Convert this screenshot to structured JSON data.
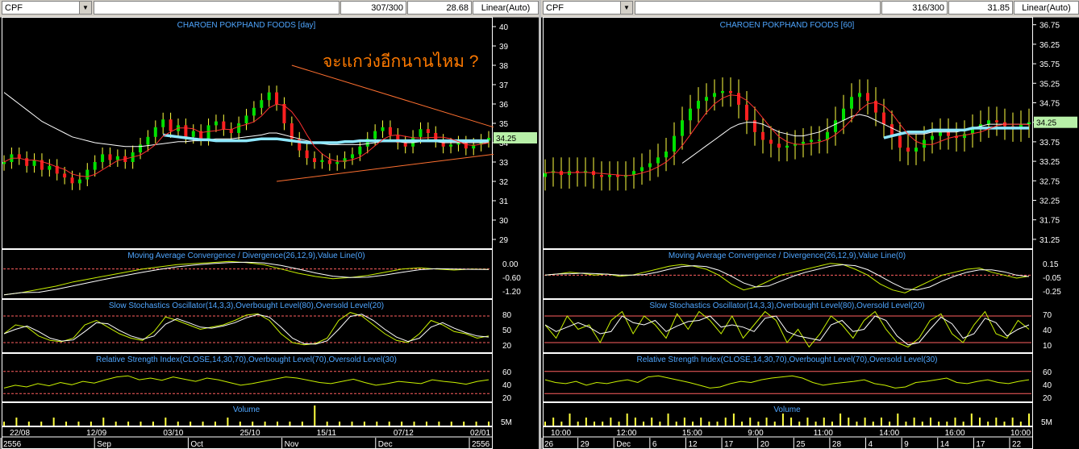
{
  "colors": {
    "bg": "#000000",
    "grid": "#ffffff",
    "title": "#4fa6ff",
    "axis_text": "#ffffff",
    "price_tag_bg": "#b8f0a8",
    "ob_line": "#ff6060",
    "osc_line": "#c8f000",
    "osc_signal": "#ffffff",
    "macd_line": "#c8f000",
    "trend_line": "#ff7030",
    "cyan_ma": "#8ee8ff",
    "annot": "#ff7a00"
  },
  "left": {
    "symbol": "CPF",
    "counter": "307/300",
    "price_readout": "28.68",
    "scale": "Linear(Auto)",
    "title": "CHAROEN POKPHAND FOODS [day]",
    "annotation": "จะแกว่งอีกนานไหม ?",
    "last_price": "34.25",
    "macd_title": "Moving Average Convergence / Divergence(26,12,9),Value Line(0)",
    "stoch_title": "Slow Stochastics Oscillator(14,3,3),Overbought Level(80),Oversold Level(20)",
    "rsi_title": "Relative Strength Index(CLOSE,14,30,70),Overbought Level(70),Oversold Level(30)",
    "vol_title": "Volume",
    "price_ticks": [
      "40",
      "39",
      "38",
      "37",
      "36",
      "35",
      "34",
      "33",
      "32",
      "31",
      "30",
      "29"
    ],
    "macd_ticks": [
      "0.00",
      "-0.60",
      "-1.20"
    ],
    "stoch_ticks": [
      "80",
      "50",
      "20"
    ],
    "rsi_ticks": [
      "60",
      "40",
      "20"
    ],
    "vol_ticks": [
      "5M"
    ],
    "date_labels_top": [
      "22/08",
      "12/09",
      "03/10",
      "25/10",
      "15/11",
      "07/12",
      "02/01"
    ],
    "date_labels_bottom": [
      "2556",
      "Sep",
      "Oct",
      "Nov",
      "Dec",
      "2556"
    ]
  },
  "right": {
    "symbol": "CPF",
    "counter": "316/300",
    "price_readout": "31.85",
    "scale": "Linear(Auto)",
    "title": "CHAROEN POKPHAND FOODS [60]",
    "last_price": "34.25",
    "macd_title": "Moving Average Convergence / Divergence(26,12,9),Value Line(0)",
    "stoch_title": "Slow Stochastics Oscillator(14,3,3),Overbought Level(80),Oversold Level(20)",
    "rsi_title": "Relative Strength Index(CLOSE,14,30,70),Overbought Level(70),Oversold Level(30)",
    "vol_title": "Volume",
    "price_ticks": [
      "36.75",
      "36.25",
      "35.75",
      "35.25",
      "34.75",
      "34.25",
      "33.75",
      "33.25",
      "32.75",
      "32.25",
      "31.75",
      "31.25"
    ],
    "macd_ticks": [
      "0.15",
      "-0.05",
      "-0.25"
    ],
    "stoch_ticks": [
      "70",
      "40",
      "10"
    ],
    "rsi_ticks": [
      "60",
      "40",
      "20"
    ],
    "vol_ticks": [
      "5M"
    ],
    "date_labels_top": [
      "10:00",
      "12:00",
      "15:00",
      "9:00",
      "11:00",
      "14:00",
      "16:00",
      "10:00"
    ],
    "date_labels_bottom": [
      "26",
      "29",
      "Dec",
      "6",
      "12",
      "17",
      "20",
      "25",
      "28",
      "4",
      "9",
      "14",
      "17",
      "22"
    ]
  },
  "chart_data": [
    {
      "type": "candlestick",
      "panel": "left",
      "title": "CHAROEN POKPHAND FOODS [day]",
      "ylim": [
        28.5,
        40.5
      ],
      "close": [
        33.0,
        33.4,
        33.2,
        32.8,
        33.1,
        32.6,
        32.8,
        32.4,
        32.2,
        31.9,
        32.1,
        32.6,
        33.0,
        33.4,
        33.1,
        33.3,
        33.0,
        33.5,
        33.9,
        34.3,
        34.8,
        35.2,
        34.6,
        34.9,
        34.3,
        34.6,
        34.2,
        34.9,
        35.1,
        34.7,
        34.5,
        35.0,
        35.4,
        35.8,
        36.2,
        36.6,
        36.0,
        35.0,
        34.2,
        33.6,
        33.2,
        33.0,
        33.1,
        32.9,
        33.0,
        33.2,
        33.4,
        33.8,
        34.2,
        34.6,
        34.8,
        34.4,
        34.0,
        33.8,
        34.3,
        34.7,
        34.5,
        34.1,
        33.8,
        33.9,
        34.0,
        33.7,
        33.9,
        34.1,
        34.25
      ],
      "ma_white": [
        36.6,
        36.3,
        36.0,
        35.7,
        35.4,
        35.1,
        34.9,
        34.7,
        34.5,
        34.3,
        34.2,
        34.1,
        34.0,
        33.95,
        33.9,
        33.85,
        33.8,
        33.8,
        33.8,
        33.85,
        33.9,
        33.95,
        34.0,
        34.05,
        34.05,
        34.1,
        34.1,
        34.15,
        34.2,
        34.2,
        34.2,
        34.25,
        34.3,
        34.35,
        34.4,
        34.5,
        34.5,
        34.4,
        34.3,
        34.2,
        34.1,
        34.0,
        33.95,
        33.9,
        33.9,
        33.9,
        33.9,
        33.9,
        33.95,
        34.0,
        34.05,
        34.05,
        34.05,
        34.0,
        34.0,
        34.05,
        34.05,
        34.05,
        34.0,
        34.0,
        34.0,
        34.0,
        34.0,
        34.0,
        34.0
      ],
      "ma_cyan": [
        null,
        null,
        null,
        null,
        null,
        null,
        null,
        null,
        null,
        null,
        null,
        null,
        null,
        null,
        null,
        null,
        null,
        null,
        null,
        null,
        null,
        34.4,
        34.35,
        34.3,
        34.25,
        34.2,
        34.15,
        34.15,
        34.1,
        34.1,
        34.1,
        34.1,
        34.1,
        34.15,
        34.2,
        34.2,
        34.2,
        34.15,
        34.1,
        34.05,
        34.0,
        34.0,
        34.0,
        34.0,
        34.0,
        34.05,
        34.05,
        34.1,
        34.1,
        34.1,
        34.1,
        34.1,
        34.1,
        34.1,
        34.1,
        34.1,
        34.1,
        34.1,
        34.1,
        34.1,
        34.1,
        34.1,
        34.1,
        34.1,
        34.1
      ],
      "trendlines": [
        {
          "from": [
            38,
            38.0
          ],
          "to": [
            64,
            34.8
          ]
        },
        {
          "from": [
            36,
            32.0
          ],
          "to": [
            64,
            33.4
          ]
        }
      ],
      "macd": [
        -1.2,
        -1.1,
        -0.95,
        -0.8,
        -0.6,
        -0.45,
        -0.3,
        -0.15,
        0.0,
        0.1,
        0.2,
        0.25,
        0.3,
        0.35,
        0.3,
        0.2,
        0.0,
        -0.2,
        -0.35,
        -0.45,
        -0.4,
        -0.3,
        -0.15,
        0.0,
        0.05,
        0.0,
        -0.05,
        0.0,
        -0.02
      ],
      "stoch": [
        40,
        60,
        55,
        35,
        25,
        22,
        30,
        60,
        70,
        55,
        40,
        30,
        25,
        45,
        78,
        70,
        60,
        50,
        55,
        60,
        70,
        82,
        85,
        70,
        40,
        20,
        15,
        18,
        30,
        70,
        88,
        80,
        60,
        40,
        25,
        20,
        40,
        70,
        60,
        45,
        40,
        30,
        35
      ],
      "rsi": [
        40,
        45,
        42,
        48,
        44,
        50,
        46,
        52,
        49,
        55,
        60,
        62,
        55,
        58,
        54,
        60,
        56,
        52,
        58,
        55,
        50,
        45,
        48,
        52,
        56,
        60,
        58,
        54,
        50,
        48,
        52,
        56,
        50,
        45,
        48,
        52,
        50,
        48,
        55,
        52,
        50,
        47,
        52,
        55
      ],
      "volume": [
        1,
        2,
        1,
        1,
        2,
        1,
        1,
        1,
        2,
        1,
        1,
        1,
        1,
        2,
        1,
        1,
        1,
        1,
        2,
        1,
        1,
        1,
        1,
        1,
        1,
        5,
        1,
        1,
        1,
        1,
        1,
        1,
        1,
        1,
        1,
        1,
        1,
        1,
        1,
        1
      ]
    },
    {
      "type": "candlestick",
      "panel": "right",
      "title": "CHAROEN POKPHAND FOODS [60]",
      "ylim": [
        31.0,
        36.95
      ],
      "close": [
        32.95,
        33.0,
        32.9,
        33.0,
        32.95,
        33.0,
        32.9,
        32.85,
        32.9,
        32.85,
        32.9,
        33.0,
        33.1,
        33.2,
        33.35,
        33.5,
        33.9,
        34.3,
        34.6,
        34.8,
        34.9,
        35.0,
        35.05,
        35.0,
        34.7,
        34.3,
        34.0,
        33.8,
        33.7,
        33.6,
        33.65,
        33.7,
        33.75,
        33.8,
        33.8,
        34.0,
        34.3,
        34.6,
        34.9,
        35.0,
        34.8,
        34.5,
        34.2,
        33.9,
        33.6,
        33.5,
        33.6,
        33.8,
        33.9,
        34.0,
        33.9,
        33.85,
        33.95,
        34.1,
        34.2,
        34.3,
        34.25,
        34.15,
        34.1,
        34.2,
        34.25
      ],
      "ma_white": [
        null,
        null,
        null,
        null,
        null,
        null,
        null,
        null,
        null,
        null,
        null,
        null,
        null,
        null,
        null,
        null,
        null,
        33.2,
        33.35,
        33.5,
        33.65,
        33.8,
        33.95,
        34.1,
        34.2,
        34.25,
        34.25,
        34.2,
        34.1,
        34.0,
        33.95,
        33.9,
        33.9,
        33.95,
        34.0,
        34.1,
        34.2,
        34.3,
        34.4,
        34.45,
        34.4,
        34.3,
        34.2,
        34.1,
        34.0,
        33.95,
        33.95,
        33.95,
        34.0,
        34.0,
        34.0,
        34.0,
        34.05,
        34.1,
        34.15,
        34.2,
        34.2,
        34.2,
        34.2,
        34.2,
        34.2
      ],
      "ma_cyan": [
        null,
        null,
        null,
        null,
        null,
        null,
        null,
        null,
        null,
        null,
        null,
        null,
        null,
        null,
        null,
        null,
        null,
        null,
        null,
        null,
        null,
        null,
        null,
        null,
        null,
        null,
        null,
        null,
        null,
        null,
        null,
        null,
        null,
        null,
        null,
        null,
        null,
        null,
        null,
        null,
        null,
        null,
        33.85,
        33.9,
        33.95,
        34.0,
        34.0,
        34.0,
        34.05,
        34.05,
        34.05,
        34.05,
        34.05,
        34.1,
        34.1,
        34.1,
        34.1,
        34.1,
        34.1,
        34.1,
        34.1
      ],
      "macd": [
        0.0,
        0.02,
        0.05,
        0.03,
        0.0,
        0.02,
        -0.02,
        0.0,
        0.05,
        0.1,
        0.15,
        0.18,
        0.15,
        0.1,
        0.0,
        -0.15,
        -0.25,
        -0.2,
        -0.1,
        0.0,
        0.05,
        0.1,
        0.15,
        0.2,
        0.18,
        0.1,
        0.0,
        -0.15,
        -0.25,
        -0.3,
        -0.2,
        -0.1,
        0.0,
        0.05,
        0.1,
        0.12,
        0.05,
        0.0,
        -0.05,
        -0.02
      ],
      "stoch": [
        60,
        30,
        80,
        50,
        60,
        20,
        70,
        90,
        40,
        80,
        60,
        30,
        85,
        50,
        90,
        70,
        40,
        80,
        30,
        60,
        90,
        70,
        20,
        50,
        10,
        40,
        80,
        60,
        30,
        70,
        90,
        50,
        20,
        10,
        30,
        70,
        85,
        40,
        20,
        60,
        90,
        40,
        30,
        70,
        50
      ],
      "rsi": [
        55,
        50,
        48,
        52,
        45,
        50,
        48,
        52,
        55,
        50,
        60,
        62,
        58,
        54,
        50,
        45,
        40,
        42,
        48,
        52,
        50,
        55,
        58,
        60,
        62,
        58,
        50,
        45,
        48,
        50,
        52,
        55,
        48,
        45,
        40,
        42,
        50,
        52,
        55,
        58,
        50,
        48,
        52,
        55,
        50,
        48,
        52,
        55
      ],
      "volume": [
        1,
        2,
        1,
        3,
        1,
        2,
        1,
        1,
        2,
        1,
        3,
        2,
        1,
        2,
        1,
        3,
        1,
        2,
        1,
        2,
        1,
        1,
        2,
        3,
        1,
        2,
        1,
        2,
        1,
        3,
        2,
        1,
        2,
        1,
        2,
        1,
        3,
        2,
        1,
        2,
        1,
        2,
        1,
        3,
        1,
        2,
        1,
        2,
        1,
        1,
        2,
        1,
        3,
        2,
        1,
        2,
        1,
        2,
        1,
        3
      ]
    }
  ]
}
